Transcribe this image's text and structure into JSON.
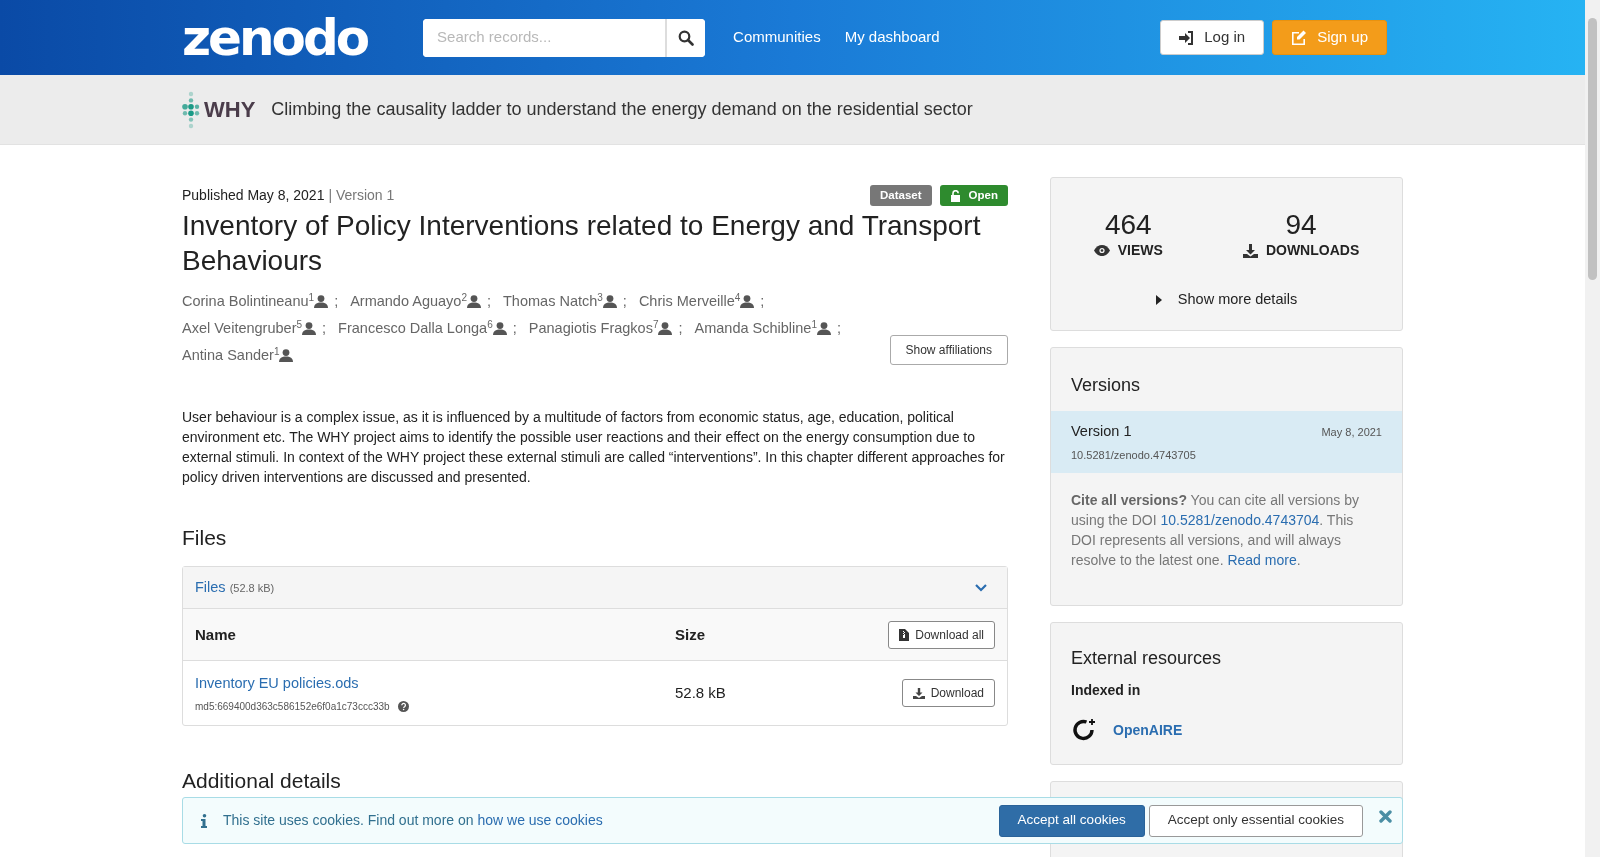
{
  "header": {
    "logo": "zenodo",
    "search": {
      "placeholder": "Search records..."
    },
    "nav": [
      "Communities",
      "My dashboard"
    ],
    "buttons": [
      {
        "kind": "login",
        "label": "Log in"
      },
      {
        "kind": "signup",
        "label": "Sign up"
      }
    ]
  },
  "community": {
    "logo_text": "WHY",
    "title": "Climbing the causality ladder to understand the energy demand on the residential sector"
  },
  "record": {
    "published": "Published May 8, 2021",
    "version": "| Version 1",
    "badges": [
      {
        "kind": "type",
        "label": "Dataset"
      },
      {
        "kind": "access",
        "label": "Open"
      }
    ],
    "title": "Inventory of Policy Interventions related to Energy and Transport Behaviours",
    "authors": [
      {
        "name": "Corina Bolintineanu",
        "affiliation": "1",
        "separator": ";"
      },
      {
        "name": "Armando Aguayo",
        "affiliation": "2",
        "separator": ";"
      },
      {
        "name": "Thomas Natch",
        "affiliation": "3",
        "separator": ";"
      },
      {
        "name": "Chris Merveille",
        "affiliation": "4",
        "separator": ";"
      },
      {
        "name": "Axel Veitengruber",
        "affiliation": "5",
        "separator": ";"
      },
      {
        "name": "Francesco Dalla Longa",
        "affiliation": "6",
        "separator": ";"
      },
      {
        "name": "Panagiotis Fragkos",
        "affiliation": "7",
        "separator": ";"
      },
      {
        "name": "Amanda Schibline",
        "affiliation": "1",
        "separator": ";"
      },
      {
        "name": "Antina Sander",
        "affiliation": "1"
      }
    ],
    "show_affiliations": "Show affiliations",
    "description": "User behaviour is a complex issue, as it is influenced by a multitude of factors from economic status, age, education, political environment etc. The WHY project aims to identify the possible user reactions and their effect on the energy consumption due to external stimuli. In context of the WHY project these external stimuli are called “interventions”. In this chapter different approaches for policy driven interventions are discussed and presented."
  },
  "files": {
    "heading": "Files",
    "panel_title": "Files",
    "panel_size": "(52.8 kB)",
    "expanded": true,
    "columns": [
      "Name",
      "Size"
    ],
    "download_all": "Download all",
    "rows": [
      {
        "name": "Inventory EU policies.ods",
        "checksum": "md5:669400d363c586152e6f0a1c73ccc33b",
        "size": "52.8 kB",
        "action": "Download"
      }
    ]
  },
  "additional": {
    "heading": "Additional details"
  },
  "sidebar": {
    "stats": [
      {
        "kind": "views",
        "value": "464",
        "label": "VIEWS"
      },
      {
        "kind": "downloads",
        "value": "94",
        "label": "DOWNLOADS"
      }
    ],
    "more_details": "Show more details",
    "versions": {
      "title": "Versions",
      "items": [
        {
          "label": "Version 1",
          "date": "May 8, 2021",
          "doi": "10.5281/zenodo.4743705",
          "selected": true
        }
      ],
      "cite_bold": "Cite all versions?",
      "cite_text1": "You can cite all versions by using the DOI",
      "cite_doi": "10.5281/zenodo.4743704",
      "cite_text2": ". This DOI represents all versions, and will always resolve to the latest one.",
      "read_more": "Read more",
      "cite_end": "."
    },
    "external": {
      "title": "External resources",
      "subtitle": "Indexed in",
      "items": [
        {
          "label": "OpenAIRE"
        }
      ]
    }
  },
  "cookies": {
    "text": "This site uses cookies. Find out more on",
    "link": "how we use cookies",
    "buttons": [
      {
        "kind": "primary",
        "label": "Accept all cookies"
      },
      {
        "kind": "secondary",
        "label": "Accept only essential cookies"
      }
    ]
  }
}
